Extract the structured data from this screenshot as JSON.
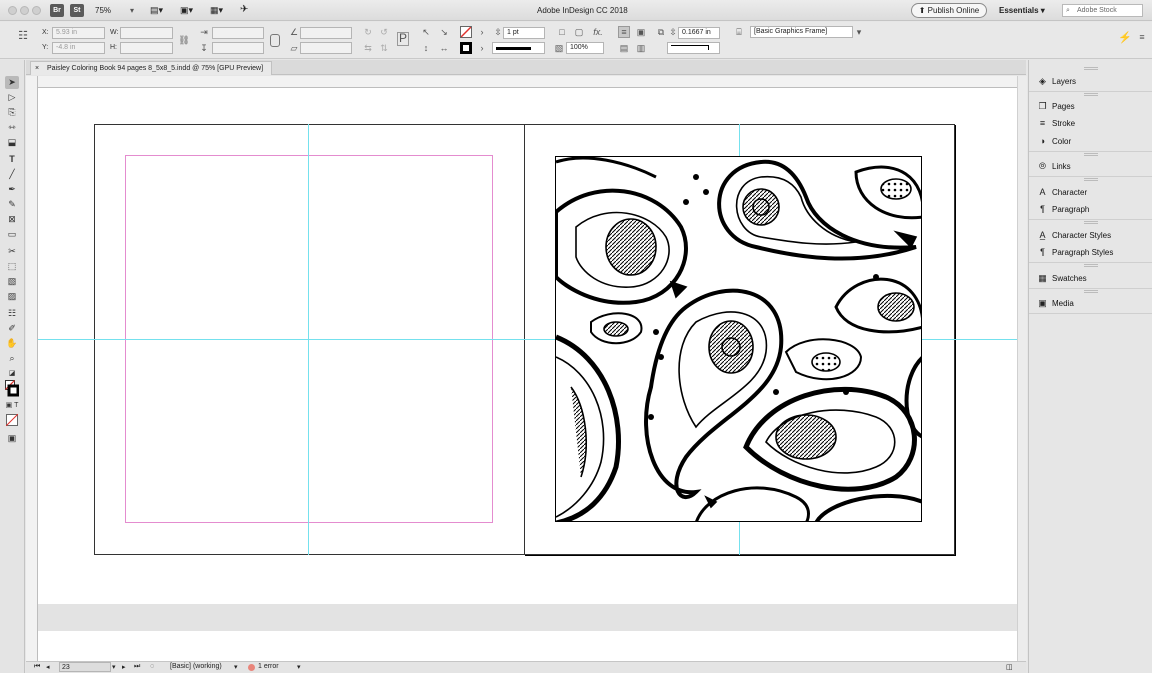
{
  "titlebar": {
    "app_title": "Adobe InDesign CC 2018",
    "zoom": "75%",
    "br_badge": "Br",
    "st_badge": "St",
    "publish_label": "Publish Online",
    "workspace": "Essentials",
    "search_placeholder": "Adobe Stock"
  },
  "control": {
    "x_label": "X:",
    "x_value": "5.93 in",
    "y_label": "Y:",
    "y_value": "-4.8 in",
    "w_label": "W:",
    "h_label": "H:",
    "stroke_weight": "1 pt",
    "opacity": "100%",
    "offset": "0.1667 in",
    "object_style": "[Basic Graphics Frame]"
  },
  "document": {
    "tab_title": "Paisley Coloring Book 94 pages 8_5x8_5.indd @ 75% [GPU Preview]"
  },
  "status": {
    "page_number": "23",
    "preflight_profile": "[Basic] (working)",
    "error_text": "1 error",
    "error_color": "#e9857b"
  },
  "panels": [
    {
      "id": "layers",
      "label": "Layers",
      "icon": "layers-icon"
    },
    {
      "id": "pages",
      "label": "Pages",
      "icon": "pages-icon"
    },
    {
      "id": "stroke",
      "label": "Stroke",
      "icon": "stroke-icon"
    },
    {
      "id": "color",
      "label": "Color",
      "icon": "color-icon"
    },
    {
      "id": "links",
      "label": "Links",
      "icon": "links-icon"
    },
    {
      "id": "character",
      "label": "Character",
      "icon": "character-icon"
    },
    {
      "id": "paragraph",
      "label": "Paragraph",
      "icon": "paragraph-icon"
    },
    {
      "id": "character_styles",
      "label": "Character Styles",
      "icon": "character-styles-icon"
    },
    {
      "id": "paragraph_styles",
      "label": "Paragraph Styles",
      "icon": "paragraph-styles-icon"
    },
    {
      "id": "swatches",
      "label": "Swatches",
      "icon": "swatches-icon"
    },
    {
      "id": "media",
      "label": "Media",
      "icon": "media-icon"
    }
  ],
  "colors": {
    "guide": "#74e1ee",
    "margin": "#e48ccf",
    "paisley": "#000000"
  }
}
